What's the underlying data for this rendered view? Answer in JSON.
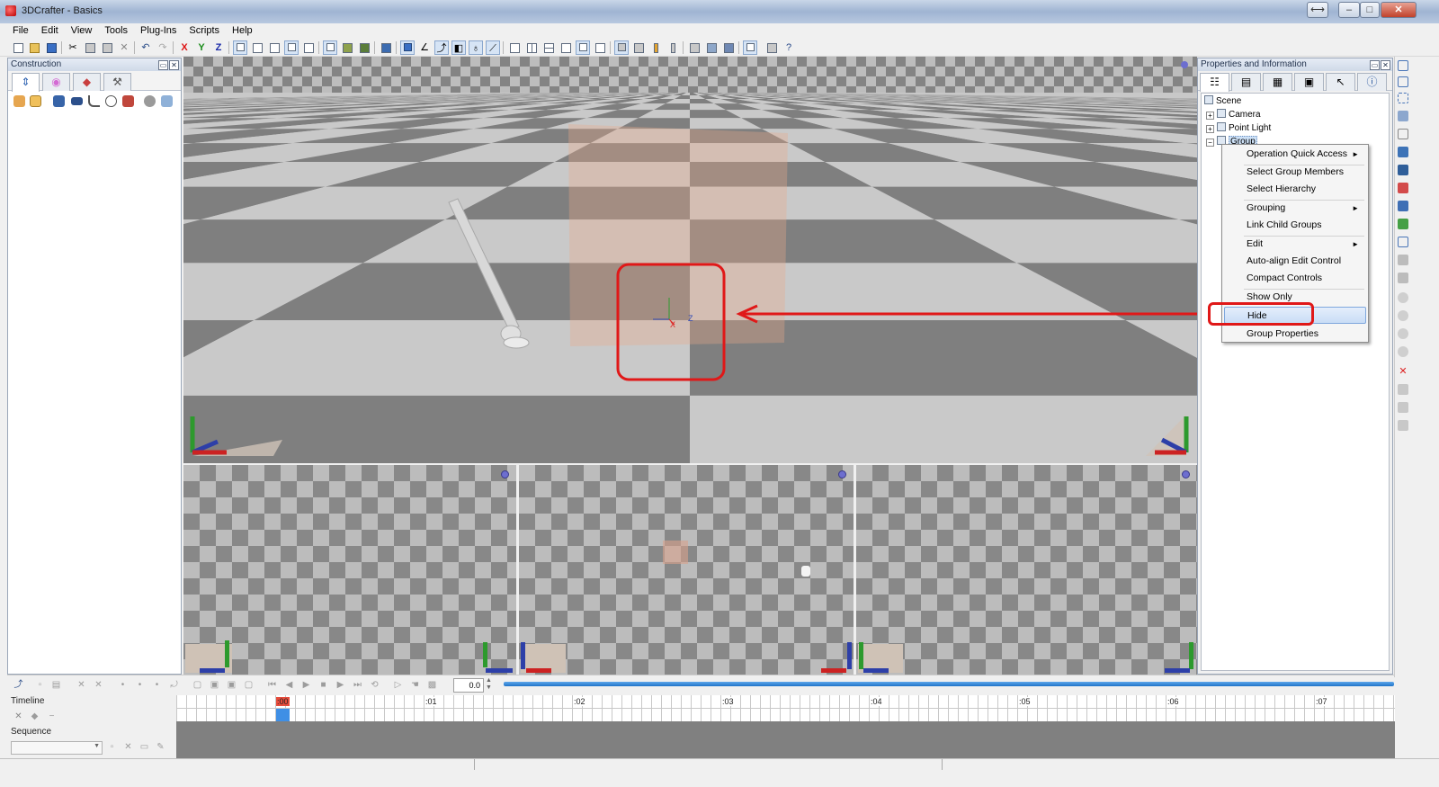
{
  "window": {
    "title": "3DCrafter - Basics",
    "buttons": {
      "minimize": "–",
      "maximize": "□",
      "close": "✕"
    }
  },
  "menu": [
    "File",
    "Edit",
    "View",
    "Tools",
    "Plug-Ins",
    "Scripts",
    "Help"
  ],
  "toolbar": {
    "x_label": "X",
    "y_label": "Y",
    "z_label": "Z"
  },
  "construction": {
    "title": "Construction",
    "tabs": [
      "⇕",
      "◉",
      "◆",
      "⚒"
    ]
  },
  "properties": {
    "title": "Properties and Information",
    "tree": [
      {
        "label": "Scene"
      },
      {
        "label": "Camera"
      },
      {
        "label": "Point Light"
      },
      {
        "label": "Group"
      }
    ],
    "expanders": {
      "expanded": "−",
      "collapsed": "+"
    }
  },
  "context_menu": {
    "items": [
      {
        "label": "Operation Quick Access",
        "submenu": true
      },
      {
        "label": "Select Group Members"
      },
      {
        "label": "Select Hierarchy"
      },
      {
        "label": "Grouping",
        "submenu": true
      },
      {
        "label": "Link Child Groups"
      },
      {
        "label": "Edit",
        "submenu": true
      },
      {
        "label": "Auto-align Edit Control"
      },
      {
        "label": "Compact Controls"
      },
      {
        "label": "Show Only"
      },
      {
        "label": "Hide",
        "highlighted": true
      },
      {
        "label": "Group Properties"
      }
    ],
    "submenu_arrow": "►"
  },
  "annotation": {
    "color": "#e01818"
  },
  "gizmo": {
    "x": "X",
    "z": "Z"
  },
  "timeline": {
    "label": "Timeline",
    "sequence_label": "Sequence",
    "time_value": "0.0",
    "ticks": [
      ":00",
      ":01",
      ":02",
      ":03",
      ":04",
      ":05",
      ":06",
      ":07"
    ],
    "current_tick": ":00"
  },
  "colors": {
    "accent": "#3f8fe5",
    "highlight": "#c9ddf6",
    "annotation_red": "#e01818"
  }
}
